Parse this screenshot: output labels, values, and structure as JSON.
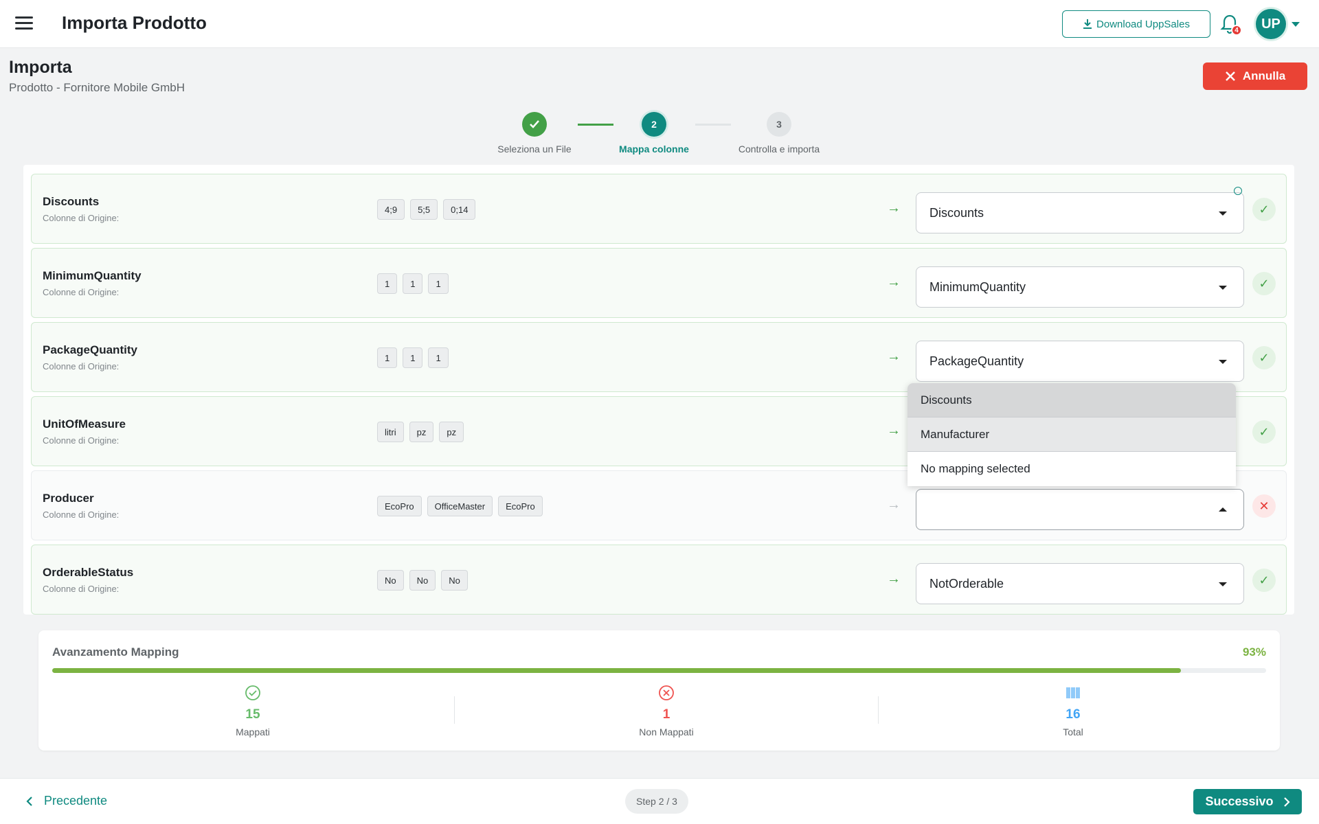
{
  "app": {
    "title": "Importa Prodotto",
    "download_label": "Download UppSales",
    "notification_count": "4",
    "avatar_initials": "UP"
  },
  "header": {
    "title": "Importa",
    "subtitle": "Prodotto - Fornitore Mobile GmbH",
    "cancel_label": "Annulla"
  },
  "stepper": {
    "steps": [
      {
        "label": "Seleziona un File",
        "number": "",
        "state": "done"
      },
      {
        "label": "Mappa colonne",
        "number": "2",
        "state": "active"
      },
      {
        "label": "Controlla e importa",
        "number": "3",
        "state": "pending"
      }
    ]
  },
  "rows": [
    {
      "name": "Discounts",
      "sub": "Colonne di Origine:",
      "samples": [
        "4;9",
        "5;5",
        "0;14"
      ],
      "selected": "Discounts",
      "mapped": true
    },
    {
      "name": "MinimumQuantity",
      "sub": "Colonne di Origine:",
      "samples": [
        "1",
        "1",
        "1"
      ],
      "selected": "MinimumQuantity",
      "mapped": true
    },
    {
      "name": "PackageQuantity",
      "sub": "Colonne di Origine:",
      "samples": [
        "1",
        "1",
        "1"
      ],
      "selected": "PackageQuantity",
      "mapped": true
    },
    {
      "name": "UnitOfMeasure",
      "sub": "Colonne di Origine:",
      "samples": [
        "litri",
        "pz",
        "pz"
      ],
      "selected": "",
      "mapped": true
    },
    {
      "name": "Producer",
      "sub": "Colonne di Origine:",
      "samples": [
        "EcoPro",
        "OfficeMaster",
        "EcoPro"
      ],
      "selected": "",
      "mapped": false
    },
    {
      "name": "OrderableStatus",
      "sub": "Colonne di Origine:",
      "samples": [
        "No",
        "No",
        "No"
      ],
      "selected": "NotOrderable",
      "mapped": true
    }
  ],
  "dropdown": {
    "options": [
      "Discounts",
      "Manufacturer",
      "No mapping selected"
    ]
  },
  "progress": {
    "title": "Avanzamento Mapping",
    "percent_label": "93%",
    "percent_value": 0.93,
    "mapped_count": "15",
    "mapped_label": "Mappati",
    "unmapped_count": "1",
    "unmapped_label": "Non Mappati",
    "total_count": "16",
    "total_label": "Total"
  },
  "footer": {
    "prev_label": "Precedente",
    "step_indicator": "Step 2 / 3",
    "next_label": "Successivo"
  },
  "colors": {
    "teal": "#0f8a80",
    "green": "#43a047",
    "red": "#ea4335",
    "progress": "#7cb342",
    "blue": "#64b5f6"
  }
}
